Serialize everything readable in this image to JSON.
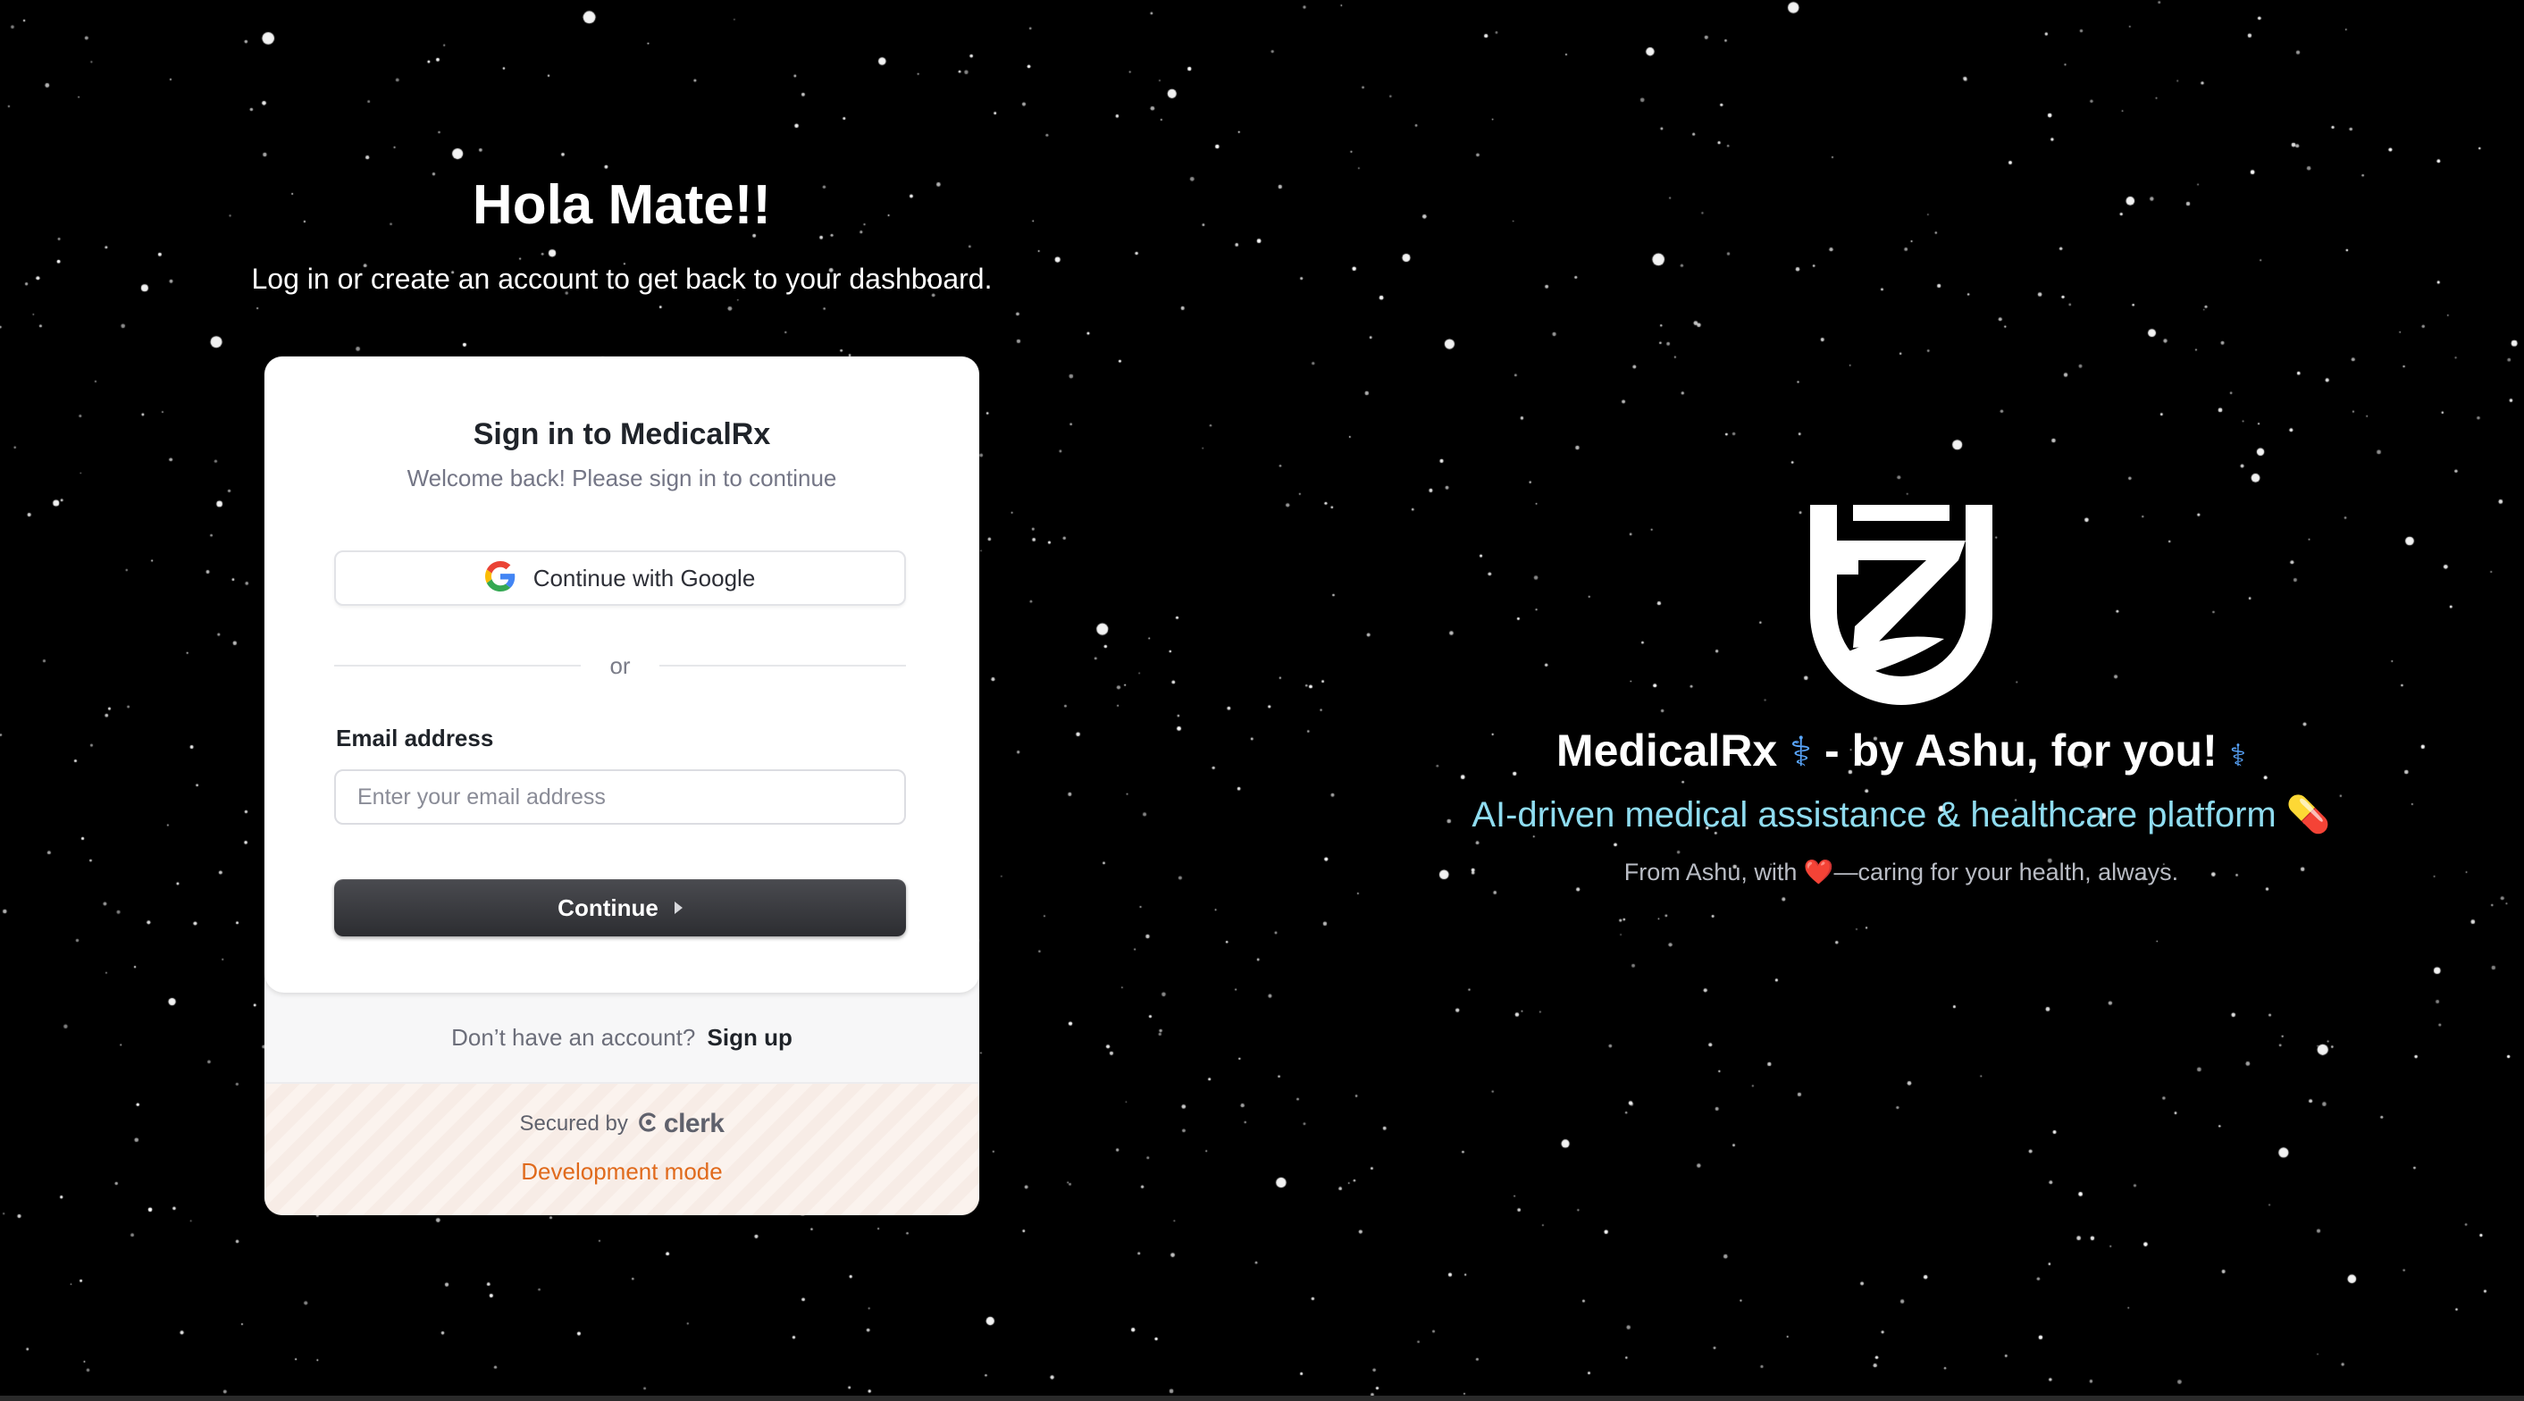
{
  "hero": {
    "title": "Hola Mate!!",
    "subtitle": "Log in or create an account to get back to your dashboard."
  },
  "signin_card": {
    "title": "Sign in to MedicalRx",
    "subtitle": "Welcome back! Please sign in to continue",
    "google_button_label": "Continue with Google",
    "divider_text": "or",
    "email_label": "Email address",
    "email_placeholder": "Enter your email address",
    "email_value": "",
    "continue_label": "Continue",
    "signup_prompt": "Don’t have an account?",
    "signup_link": "Sign up",
    "secured_by": "Secured by",
    "provider_name": "clerk",
    "dev_mode": "Development mode"
  },
  "brand": {
    "name": "MedicalRx",
    "tagline_suffix": "- by Ashu, for you!",
    "caduceus_emoji": "⚕",
    "subheading": "AI-driven medical assistance & healthcare platform",
    "pill_emoji": "💊",
    "credit_prefix": "From Ashu, with",
    "heart_emoji": "❤️",
    "credit_suffix": "—caring for your health, always."
  },
  "icons": {
    "google": "google-g-icon",
    "continue_caret": "caret-right-icon",
    "clerk": "clerk-logo-icon",
    "brand_logo": "medicalrx-logo-icon"
  },
  "colors": {
    "background": "#000000",
    "card": "#ffffff",
    "primary_button": "#2f3034",
    "dev_mode": "#e06a1c",
    "tagline": "#8fdcf0",
    "caduceus": "#5aa7ff"
  }
}
